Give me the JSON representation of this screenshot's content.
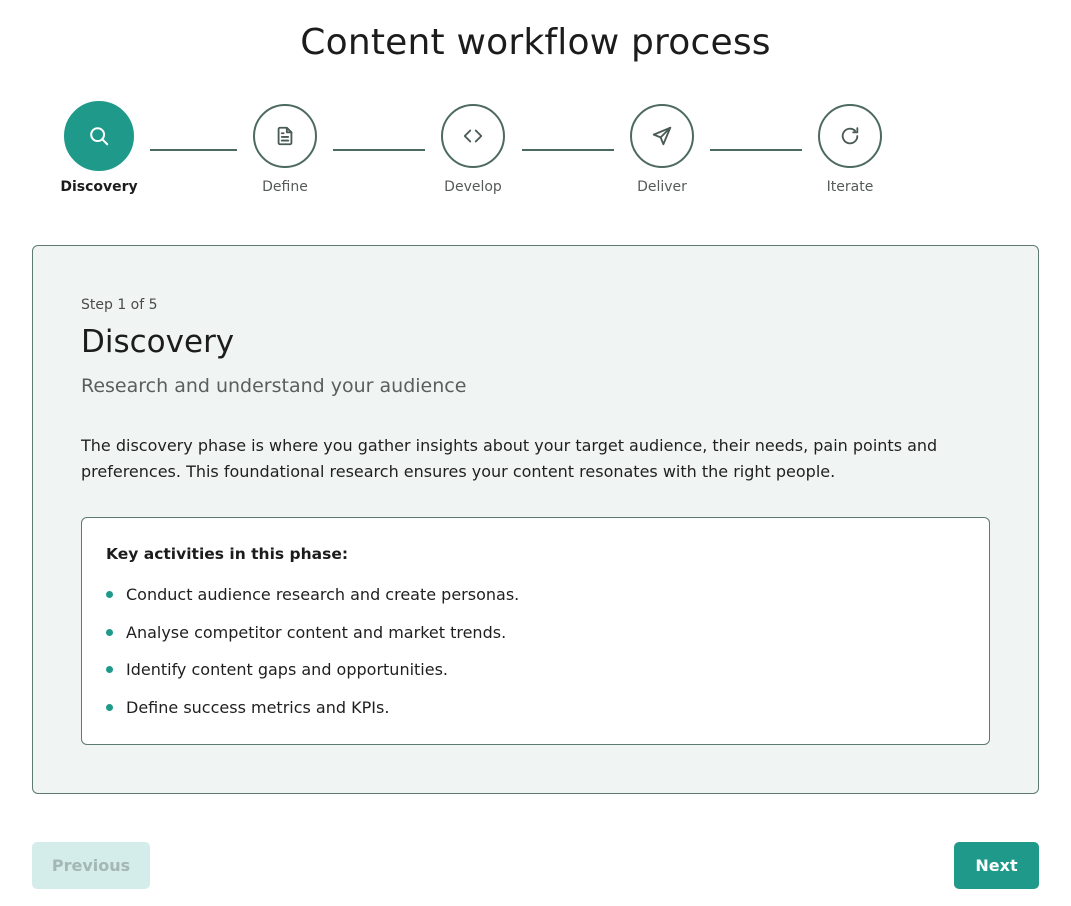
{
  "page": {
    "title": "Content workflow process"
  },
  "stepper": {
    "steps": [
      {
        "label": "Discovery",
        "icon": "search-icon",
        "active": true
      },
      {
        "label": "Define",
        "icon": "document-icon",
        "active": false
      },
      {
        "label": "Develop",
        "icon": "code-icon",
        "active": false
      },
      {
        "label": "Deliver",
        "icon": "send-icon",
        "active": false
      },
      {
        "label": "Iterate",
        "icon": "refresh-icon",
        "active": false
      }
    ]
  },
  "panel": {
    "step_count": "Step 1 of 5",
    "title": "Discovery",
    "subtitle": "Research and understand your audience",
    "description": "The discovery phase is where you gather insights about your target audience, their needs, pain points and preferences. This foundational research ensures your content resonates with the right people.",
    "activities": {
      "heading": "Key activities in this phase:",
      "items": [
        "Conduct audience research and create personas.",
        "Analyse competitor content and market trends.",
        "Identify content gaps and opportunities.",
        "Define success metrics and KPIs."
      ]
    }
  },
  "nav": {
    "previous_label": "Previous",
    "next_label": "Next",
    "previous_disabled": true
  },
  "colors": {
    "accent": "#1f9a8a",
    "step_border": "#4d6a5f",
    "panel_bg": "#f0f5f4",
    "disabled_bg": "#d4ecea"
  }
}
